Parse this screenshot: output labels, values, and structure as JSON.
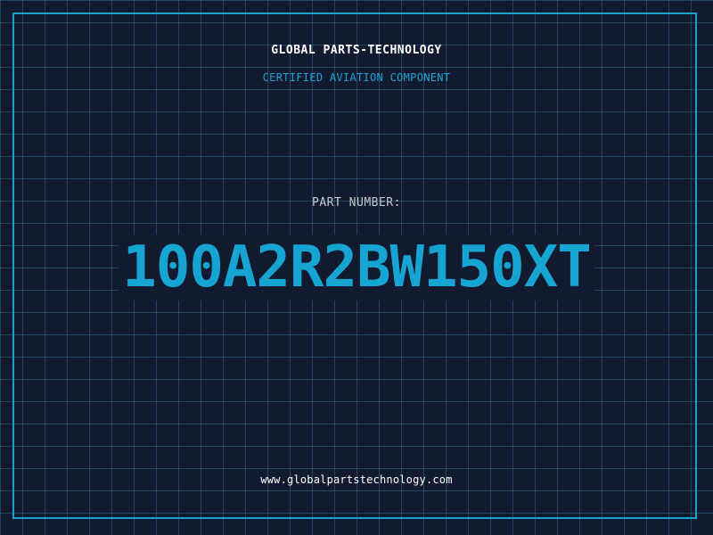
{
  "header": {
    "company": "GLOBAL PARTS-TECHNOLOGY",
    "subtitle": "CERTIFIED AVIATION COMPONENT"
  },
  "part": {
    "label": "PART NUMBER:",
    "number": "100A2R2BW150XT"
  },
  "footer": {
    "website": "www.globalpartstechnology.com"
  },
  "colors": {
    "background": "#111a2e",
    "grid": "#286e8c",
    "accent": "#16a5d3",
    "frame": "#19a3cc",
    "text": "#ffffff",
    "label": "#c3c8d2"
  }
}
